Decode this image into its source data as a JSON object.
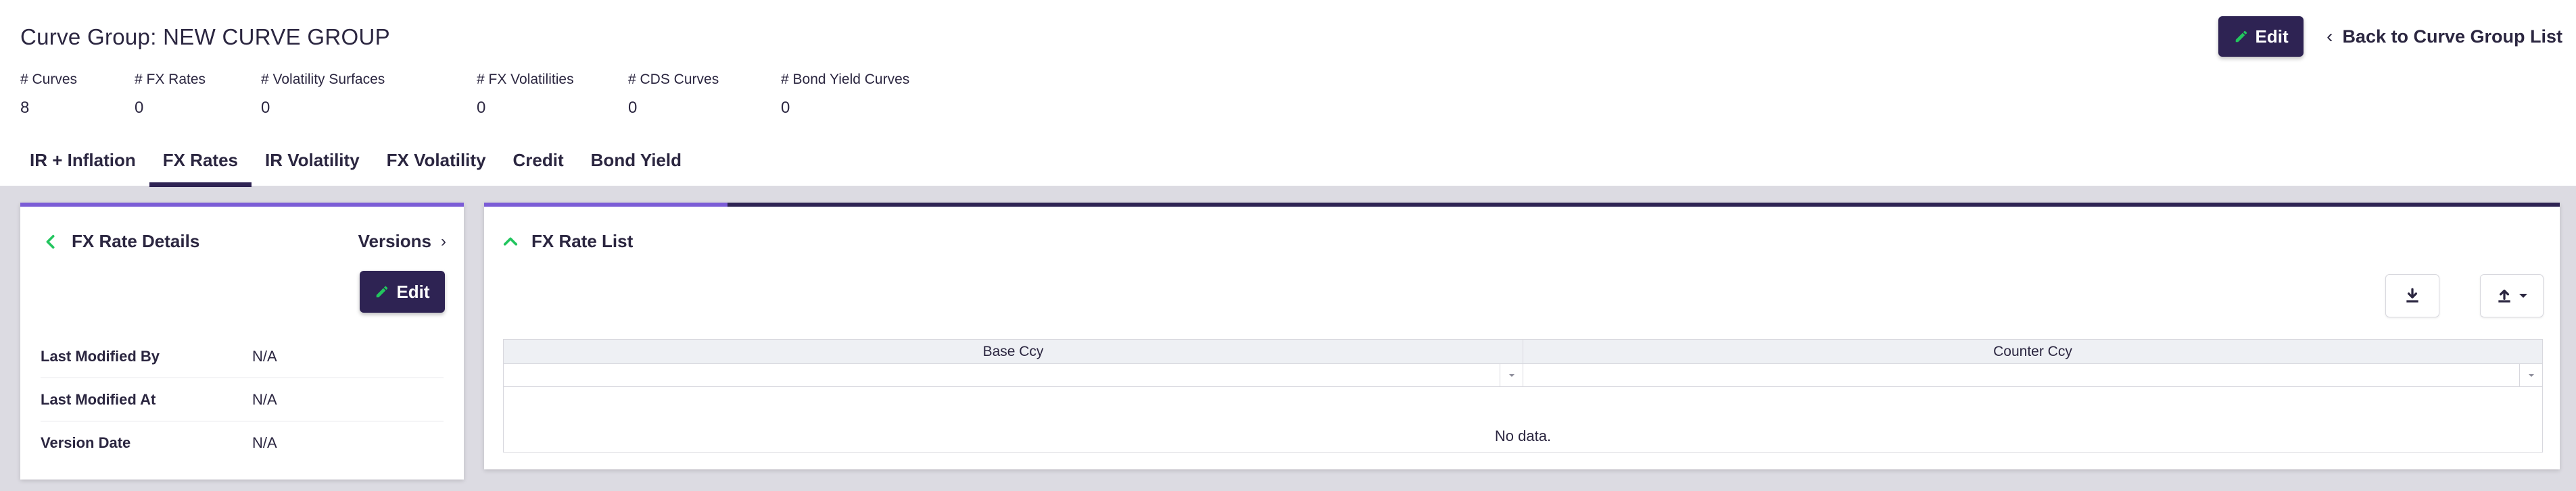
{
  "header": {
    "title": "Curve Group: NEW CURVE GROUP",
    "edit_label": "Edit",
    "back_label": "Back to Curve Group List"
  },
  "stats": [
    {
      "label": "# Curves",
      "value": "8"
    },
    {
      "label": "# FX Rates",
      "value": "0"
    },
    {
      "label": "# Volatility Surfaces",
      "value": "0"
    },
    {
      "label": "# FX Volatilities",
      "value": "0"
    },
    {
      "label": "# CDS Curves",
      "value": "0"
    },
    {
      "label": "# Bond Yield Curves",
      "value": "0"
    }
  ],
  "tabs": [
    {
      "label": "IR + Inflation",
      "active": false
    },
    {
      "label": "FX Rates",
      "active": true
    },
    {
      "label": "IR Volatility",
      "active": false
    },
    {
      "label": "FX Volatility",
      "active": false
    },
    {
      "label": "Credit",
      "active": false
    },
    {
      "label": "Bond Yield",
      "active": false
    }
  ],
  "details_panel": {
    "title": "FX Rate Details",
    "versions_label": "Versions",
    "edit_label": "Edit",
    "rows": [
      {
        "label": "Last Modified By",
        "value": "N/A"
      },
      {
        "label": "Last Modified At",
        "value": "N/A"
      },
      {
        "label": "Version Date",
        "value": "N/A"
      }
    ]
  },
  "list_panel": {
    "title": "FX Rate List",
    "columns": [
      "Base Ccy",
      "Counter Ccy"
    ],
    "empty_text": "No data."
  },
  "colors": {
    "primary": "#2e2353",
    "accent": "#7b5cd6",
    "green": "#22c55e",
    "background": "#dcdbe2"
  }
}
